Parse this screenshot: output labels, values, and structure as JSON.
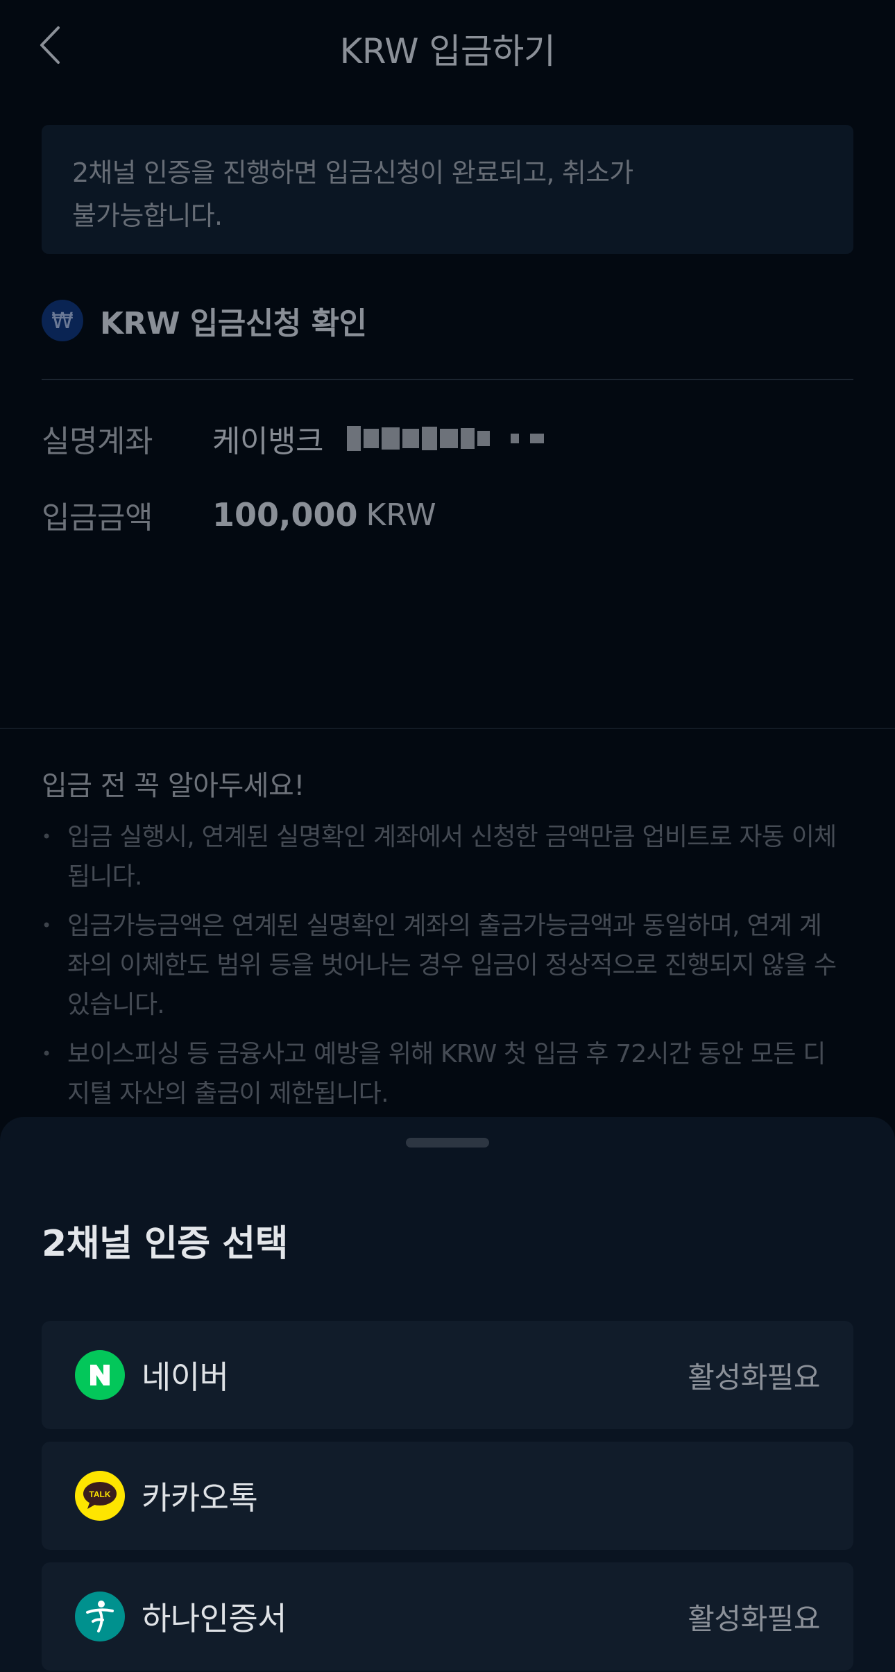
{
  "header": {
    "title": "KRW 입금하기"
  },
  "notice": {
    "line1": "2채널 인증을 진행하면 입금신청이 완료되고, 취소가",
    "line2": "불가능합니다."
  },
  "confirm": {
    "badge": "₩",
    "title": "KRW 입금신청 확인",
    "account_label": "실명계좌",
    "bank_name": "케이뱅크",
    "amount_label": "입금금액",
    "amount_value": "100,000",
    "amount_unit": "KRW"
  },
  "tips": {
    "title": "입금 전 꼭 알아두세요!",
    "items": [
      "입금 실행시, 연계된 실명확인 계좌에서 신청한 금액만큼 업비트로 자동 이체됩니다.",
      "입금가능금액은 연계된 실명확인 계좌의 출금가능금액과 동일하며, 연계 계좌의 이체한도 범위 등을 벗어나는 경우 입금이 정상적으로 진행되지 않을 수 있습니다.",
      "보이스피싱 등 금융사고 예방을 위해 KRW 첫 입금 후 72시간 동안 모든 디지털 자산의 출금이 제한됩니다."
    ]
  },
  "sheet": {
    "title": "2채널 인증 선택",
    "options": [
      {
        "label": "네이버",
        "status": "활성화필요",
        "icon": "naver-icon",
        "icon_text": "N",
        "color": "#03c75a"
      },
      {
        "label": "카카오톡",
        "status": "",
        "icon": "kakaotalk-icon",
        "icon_text": "TALK",
        "color": "#fee500"
      },
      {
        "label": "하나인증서",
        "status": "활성화필요",
        "icon": "hana-certificate-icon",
        "icon_text": "",
        "color": "#00918e"
      }
    ]
  }
}
